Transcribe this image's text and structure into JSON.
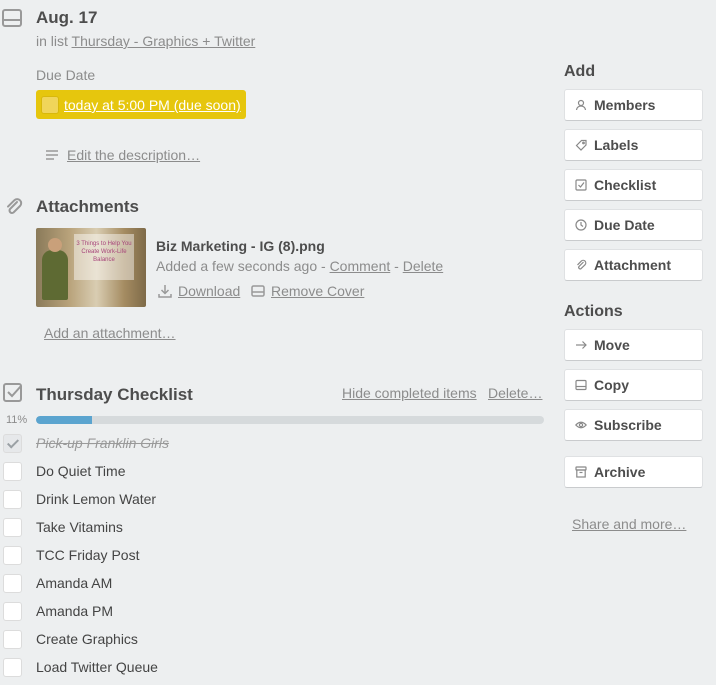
{
  "card": {
    "title": "Aug. 17",
    "in_list_prefix": "in list",
    "list_name": "Thursday - Graphics + Twitter"
  },
  "due": {
    "label": "Due Date",
    "value": "today at 5:00 PM (due soon)",
    "badge_color": "#e6c60d"
  },
  "description": {
    "edit_label": "Edit the description…"
  },
  "attachments": {
    "title": "Attachments",
    "thumbnail_text": "3 Things to Help You Create Work-Life Balance",
    "file_name": "Biz Marketing - IG (8).png",
    "added_text": "Added a few seconds ago -",
    "comment_label": "Comment",
    "sep": "-",
    "delete_label": "Delete",
    "download_label": "Download",
    "remove_cover_label": "Remove Cover",
    "add_label": "Add an attachment…"
  },
  "checklist": {
    "title": "Thursday Checklist",
    "hide_completed_label": "Hide completed items",
    "delete_label": "Delete…",
    "progress_text": "11%",
    "progress_fraction": 0.11,
    "progress_color": "#5ba4cf",
    "items": [
      {
        "text": "Pick-up Franklin Girls",
        "done": true
      },
      {
        "text": "Do Quiet Time",
        "done": false
      },
      {
        "text": "Drink Lemon Water",
        "done": false
      },
      {
        "text": "Take Vitamins",
        "done": false
      },
      {
        "text": "TCC Friday Post",
        "done": false
      },
      {
        "text": "Amanda AM",
        "done": false
      },
      {
        "text": "Amanda PM",
        "done": false
      },
      {
        "text": "Create Graphics",
        "done": false
      },
      {
        "text": "Load Twitter Queue",
        "done": false
      }
    ]
  },
  "sidebar": {
    "add_heading": "Add",
    "add_buttons": [
      {
        "label": "Members",
        "icon": "person-icon"
      },
      {
        "label": "Labels",
        "icon": "tag-icon"
      },
      {
        "label": "Checklist",
        "icon": "checkbox-icon"
      },
      {
        "label": "Due Date",
        "icon": "clock-icon"
      },
      {
        "label": "Attachment",
        "icon": "paperclip-icon"
      }
    ],
    "actions_heading": "Actions",
    "action_buttons": [
      {
        "label": "Move",
        "icon": "arrow-right-icon"
      },
      {
        "label": "Copy",
        "icon": "card-icon"
      },
      {
        "label": "Subscribe",
        "icon": "eye-icon"
      },
      {
        "label": "Archive",
        "icon": "archive-icon"
      }
    ],
    "share_label": "Share and more…"
  }
}
